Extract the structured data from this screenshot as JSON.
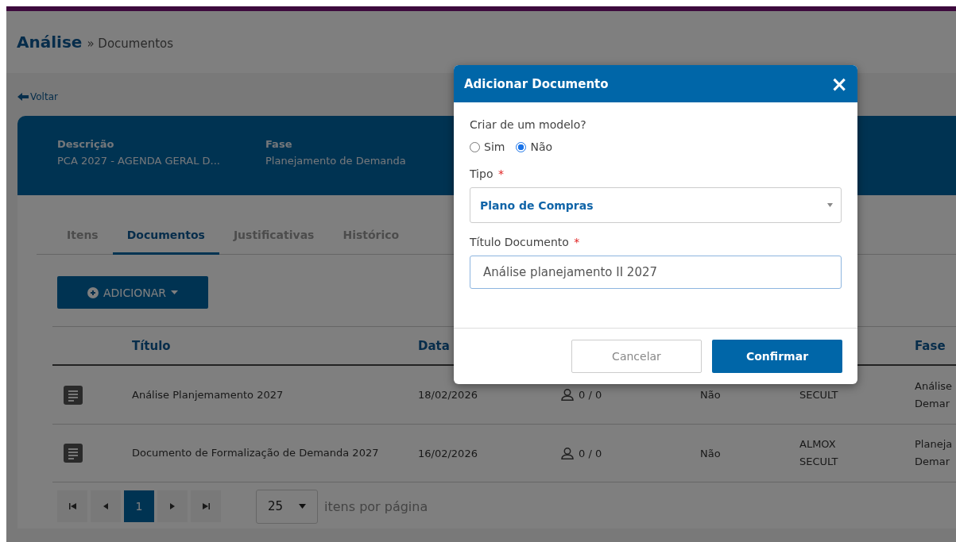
{
  "breadcrumb": {
    "title": "Análise",
    "separator": "»",
    "current": "Documentos"
  },
  "back_link": {
    "label": "Voltar"
  },
  "summary": [
    {
      "label": "Descrição",
      "value": "PCA 2027 - AGENDA GERAL D..."
    },
    {
      "label": "Fase",
      "value": "Planejamento de Demanda"
    }
  ],
  "tabs": [
    {
      "label": "Itens",
      "selected": false
    },
    {
      "label": "Documentos",
      "selected": true
    },
    {
      "label": "Justificativas",
      "selected": false
    },
    {
      "label": "Histórico",
      "selected": false
    }
  ],
  "add_button": {
    "label": "ADICIONAR"
  },
  "table": {
    "columns": [
      "Título",
      "Data",
      "Fase"
    ],
    "rows": [
      {
        "title": "Análise Planjemamento 2027",
        "date": "18/02/2026",
        "count": "0 / 0",
        "flag": "Não",
        "organ": [
          "SECULT"
        ],
        "phase": [
          "Análise",
          "Demar"
        ]
      },
      {
        "title": "Documento de Formalização de Demanda 2027",
        "date": "16/02/2026",
        "count": "0 / 0",
        "flag": "Não",
        "organ": [
          "ALMOX",
          "SECULT"
        ],
        "phase": [
          "Planeja",
          "Demar"
        ]
      }
    ]
  },
  "pagination": {
    "pages": [
      {
        "label": "1",
        "selected": true
      }
    ],
    "page_size": "25",
    "page_size_label": "itens por página"
  },
  "modal": {
    "title": "Adicionar Documento",
    "close": "×",
    "question": "Criar de um modelo?",
    "options": [
      {
        "label": "Sim",
        "selected": false
      },
      {
        "label": "Não",
        "selected": true
      }
    ],
    "type_label": "Tipo",
    "type_required_mark": "*",
    "type_value": "Plano de Compras",
    "doc_title_label": "Título Documento",
    "doc_title_required_mark": "*",
    "doc_title_value": "Análise planejamento II 2027",
    "buttons": [
      {
        "label": "Cancelar",
        "kind": "secondary"
      },
      {
        "label": "Confirmar",
        "kind": "primary"
      }
    ]
  }
}
